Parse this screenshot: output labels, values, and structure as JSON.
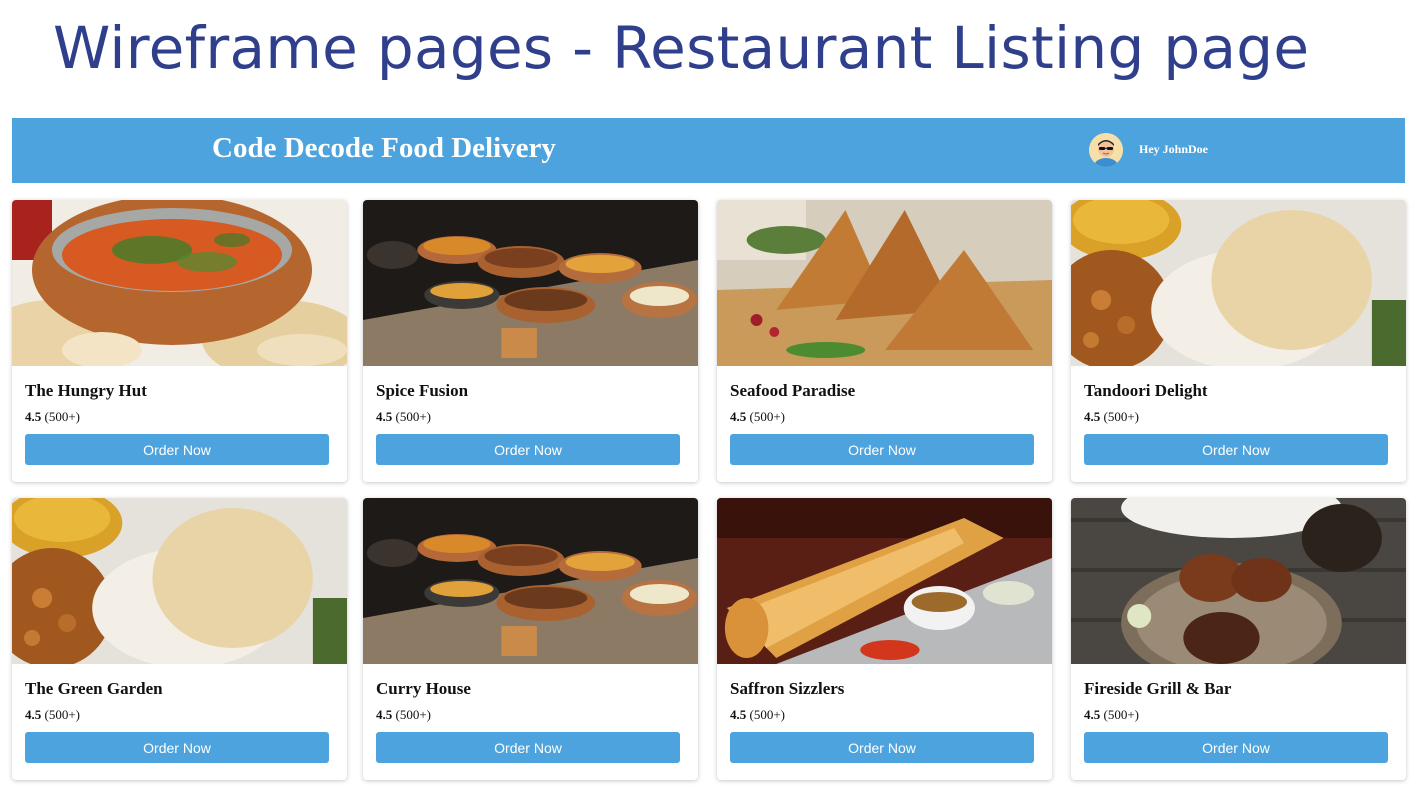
{
  "slide": {
    "title": "Wireframe pages - Restaurant Listing page"
  },
  "header": {
    "brand": "Code Decode Food Delivery",
    "greeting": "Hey JohnDoe",
    "avatar_icon": "user-avatar-icon",
    "background": "#4da3dd"
  },
  "restaurants": [
    {
      "name": "The Hungry Hut",
      "rating": "4.5",
      "reviews": "(500+)",
      "order_label": "Order Now",
      "image": "curry-bowl-naan"
    },
    {
      "name": "Spice Fusion",
      "rating": "4.5",
      "reviews": "(500+)",
      "order_label": "Order Now",
      "image": "copper-pots-buffet"
    },
    {
      "name": "Seafood Paradise",
      "rating": "4.5",
      "reviews": "(500+)",
      "order_label": "Order Now",
      "image": "samosas"
    },
    {
      "name": "Tandoori Delight",
      "rating": "4.5",
      "reviews": "(500+)",
      "order_label": "Order Now",
      "image": "dal-papad-thali"
    },
    {
      "name": "The Green Garden",
      "rating": "4.5",
      "reviews": "(500+)",
      "order_label": "Order Now",
      "image": "dal-papad-thali"
    },
    {
      "name": "Curry House",
      "rating": "4.5",
      "reviews": "(500+)",
      "order_label": "Order Now",
      "image": "copper-pots-buffet"
    },
    {
      "name": "Saffron Sizzlers",
      "rating": "4.5",
      "reviews": "(500+)",
      "order_label": "Order Now",
      "image": "masala-dosa"
    },
    {
      "name": "Fireside Grill & Bar",
      "rating": "4.5",
      "reviews": "(500+)",
      "order_label": "Order Now",
      "image": "pav-bhaji"
    }
  ],
  "colors": {
    "accent": "#4da3dd",
    "title": "#2f3f8c"
  }
}
